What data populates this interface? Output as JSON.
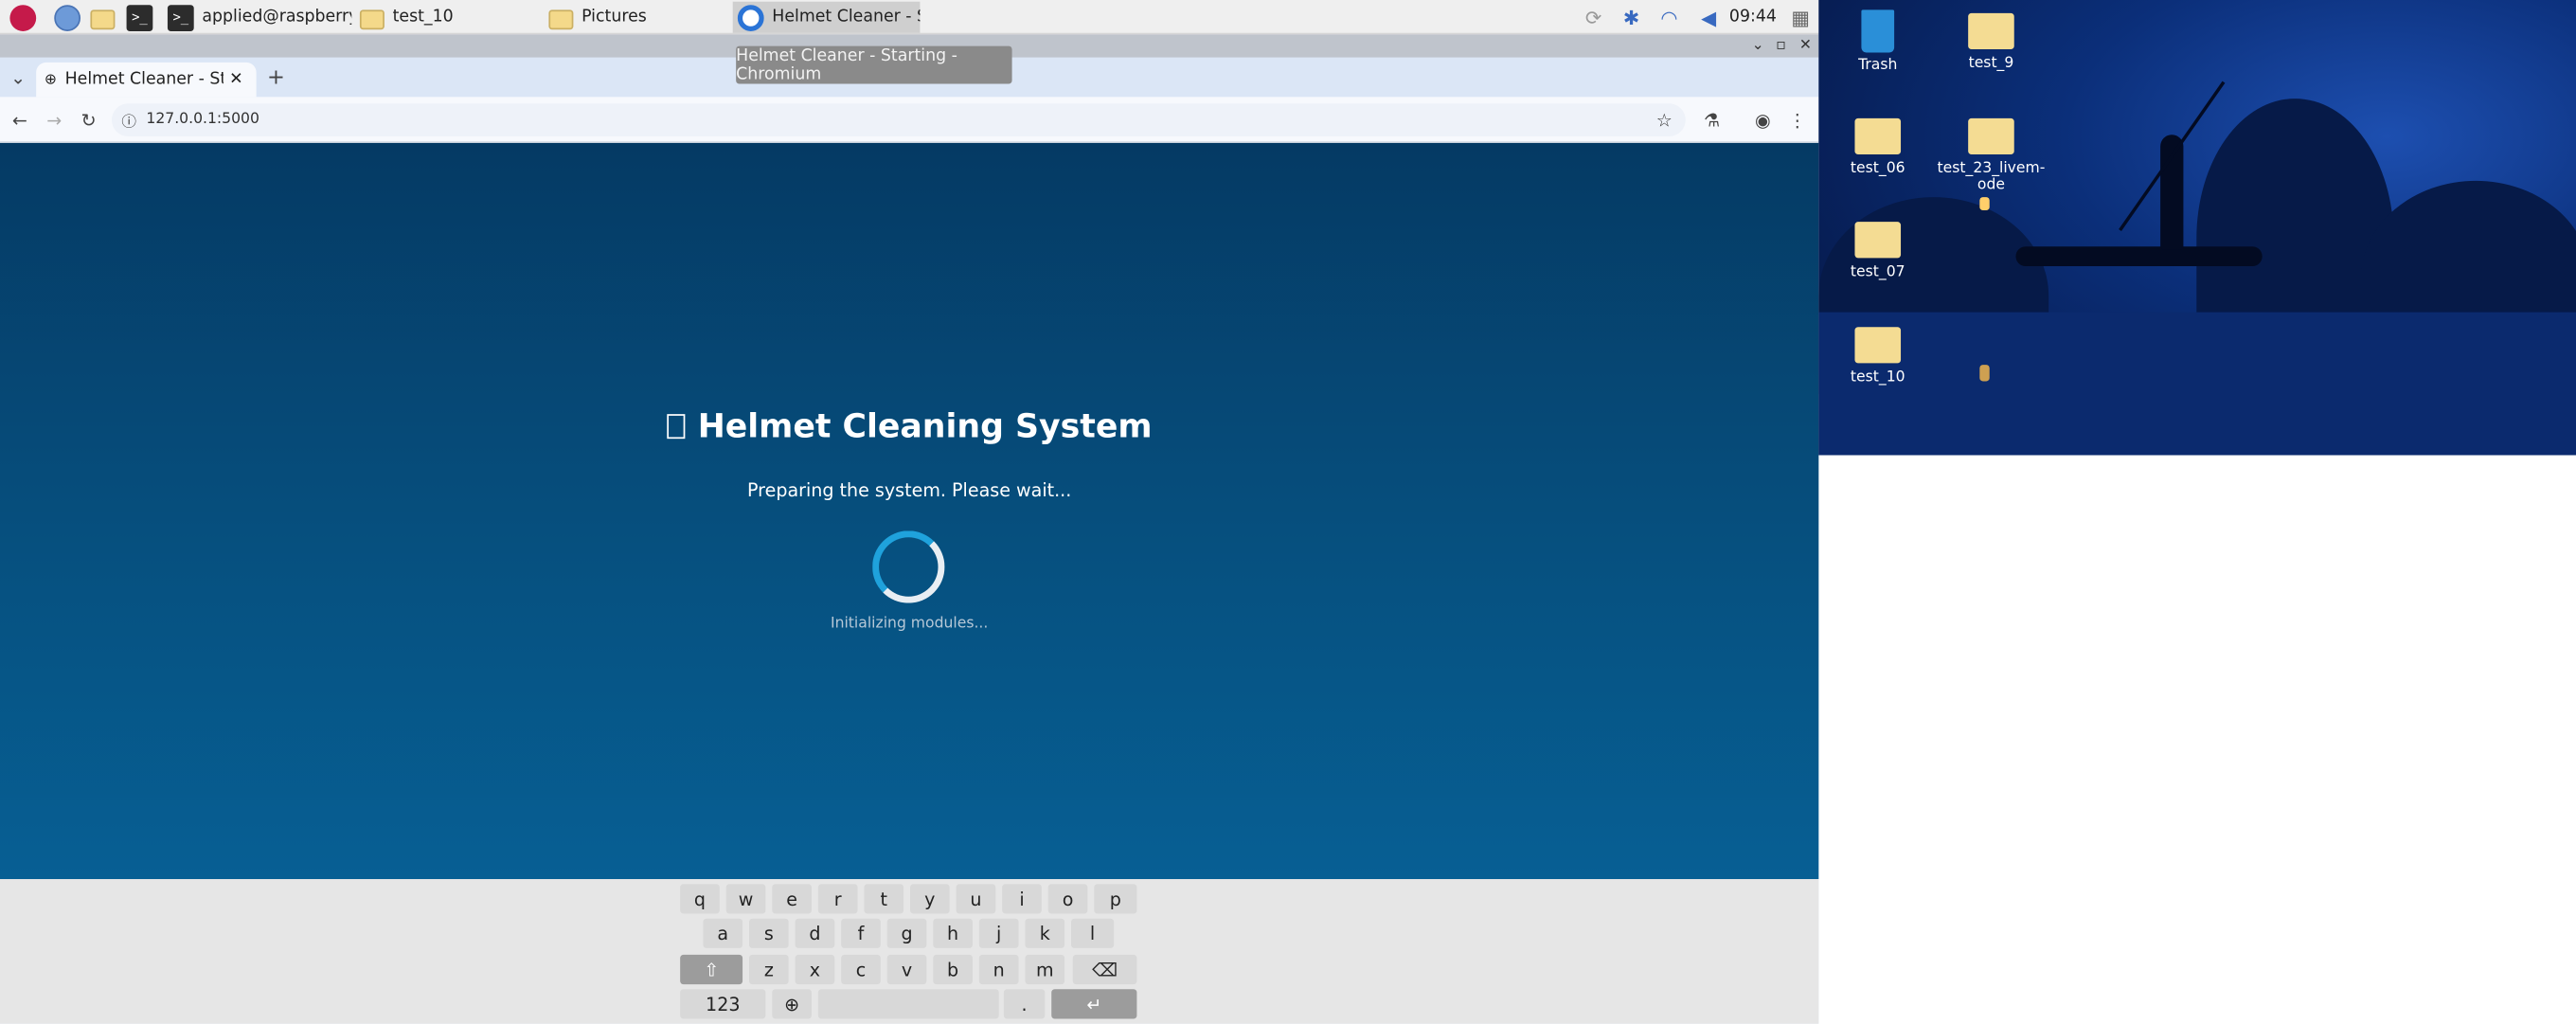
{
  "taskbar": {
    "buttons": [
      {
        "label": "applied@raspberrypi..."
      },
      {
        "label": "test_10"
      },
      {
        "label": "Pictures"
      },
      {
        "label": "Helmet Cleaner - Star..."
      }
    ],
    "clock": "09:44"
  },
  "tooltip": {
    "text": "Helmet Cleaner - Starting - Chromium"
  },
  "browser": {
    "tab_title": "Helmet Cleaner - Starting",
    "url": "127.0.0.1:5000"
  },
  "page": {
    "title": "Helmet Cleaning System",
    "subtitle": "Preparing the system. Please wait...",
    "status": "Initializing modules..."
  },
  "keyboard": {
    "row1": [
      "q",
      "w",
      "e",
      "r",
      "t",
      "y",
      "u",
      "i",
      "o",
      "p"
    ],
    "row2": [
      "a",
      "s",
      "d",
      "f",
      "g",
      "h",
      "j",
      "k",
      "l"
    ],
    "row3": [
      "z",
      "x",
      "c",
      "v",
      "b",
      "n",
      "m"
    ],
    "shift": "⇧",
    "backspace": "⌫",
    "numbers": "123",
    "globe": "⊕",
    "period": ".",
    "enter": "↵"
  },
  "desktop": {
    "icons": [
      {
        "label": "Trash"
      },
      {
        "label": "test_9"
      },
      {
        "label": "test_06"
      },
      {
        "label": "test_23_livem-ode"
      },
      {
        "label": "test_07"
      },
      {
        "label": "test_10"
      }
    ]
  }
}
